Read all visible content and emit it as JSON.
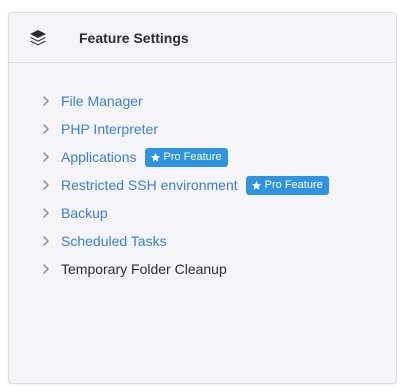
{
  "panel": {
    "title": "Feature Settings",
    "icon": "layers-icon"
  },
  "colors": {
    "link": "#3b7dd8",
    "badge": "#2f93e0",
    "text": "#2a2d35",
    "panel_bg": "#f4f4f9"
  },
  "features": [
    {
      "label": "File Manager",
      "link": true
    },
    {
      "label": "PHP Interpreter",
      "link": true
    },
    {
      "label": "Applications",
      "link": true,
      "badge": "Pro Feature"
    },
    {
      "label": "Restricted SSH environment",
      "link": true,
      "badge": "Pro Feature"
    },
    {
      "label": "Backup",
      "link": true
    },
    {
      "label": "Scheduled Tasks",
      "link": true
    },
    {
      "label": "Temporary Folder Cleanup",
      "link": false
    }
  ]
}
